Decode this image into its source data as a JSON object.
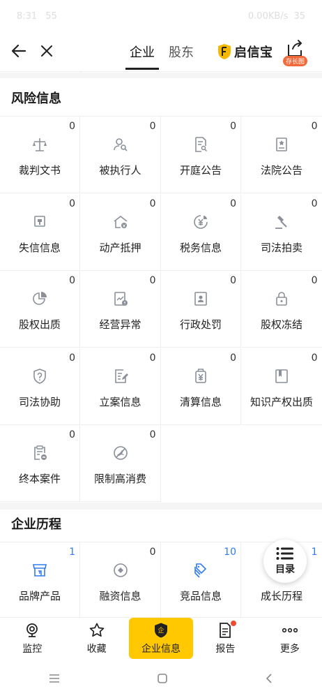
{
  "status_bar": {
    "time": "8:31",
    "extra": "55",
    "network": "0.00KB/s",
    "battery": "35"
  },
  "header": {
    "tabs": [
      {
        "label": "企业",
        "active": true
      },
      {
        "label": "股东",
        "active": false
      }
    ],
    "brand": {
      "name": "启信宝"
    },
    "share_badge": "存长图"
  },
  "risk_section": {
    "title": "风险信息",
    "items": [
      {
        "label": "裁判文书",
        "count": "0",
        "icon": "scales-icon"
      },
      {
        "label": "被执行人",
        "count": "0",
        "icon": "person-search-icon"
      },
      {
        "label": "开庭公告",
        "count": "0",
        "icon": "document-search-icon"
      },
      {
        "label": "法院公告",
        "count": "0",
        "icon": "court-notice-icon"
      },
      {
        "label": "失信信息",
        "count": "0",
        "icon": "thumbs-down-icon"
      },
      {
        "label": "动产抵押",
        "count": "0",
        "icon": "house-yen-icon"
      },
      {
        "label": "税务信息",
        "count": "0",
        "icon": "tax-yen-icon"
      },
      {
        "label": "司法拍卖",
        "count": "0",
        "icon": "gavel-icon"
      },
      {
        "label": "股权出质",
        "count": "0",
        "icon": "pie-chart-icon"
      },
      {
        "label": "经营异常",
        "count": "0",
        "icon": "chart-warning-icon"
      },
      {
        "label": "行政处罚",
        "count": "0",
        "icon": "id-card-icon"
      },
      {
        "label": "股权冻结",
        "count": "0",
        "icon": "lock-icon"
      },
      {
        "label": "司法协助",
        "count": "0",
        "icon": "shield-question-icon"
      },
      {
        "label": "立案信息",
        "count": "0",
        "icon": "edit-document-icon"
      },
      {
        "label": "清算信息",
        "count": "0",
        "icon": "yen-bag-icon"
      },
      {
        "label": "知识产权出质",
        "count": "0",
        "icon": "book-icon"
      },
      {
        "label": "终本案件",
        "count": "0",
        "icon": "clipboard-minus-icon"
      },
      {
        "label": "限制高消费",
        "count": "0",
        "icon": "no-plane-icon"
      }
    ]
  },
  "history_section": {
    "title": "企业历程",
    "items": [
      {
        "label": "品牌产品",
        "count": "1",
        "icon": "shop-icon",
        "highlight": true
      },
      {
        "label": "融资信息",
        "count": "0",
        "icon": "target-icon",
        "highlight": false
      },
      {
        "label": "竞品信息",
        "count": "10",
        "icon": "tags-icon",
        "highlight": true
      },
      {
        "label": "成长历程",
        "count": "1",
        "icon": "growth-icon",
        "highlight": true
      }
    ]
  },
  "toc_button": {
    "label": "目录"
  },
  "bottom_nav": [
    {
      "label": "监控",
      "icon": "camera-icon"
    },
    {
      "label": "收藏",
      "icon": "star-icon"
    },
    {
      "label": "企业信息",
      "icon": "company-shield-icon",
      "active": true
    },
    {
      "label": "报告",
      "icon": "report-icon",
      "dot": true
    },
    {
      "label": "更多",
      "icon": "more-dots-icon"
    }
  ],
  "colors": {
    "accent": "#ffc800",
    "link_blue": "#2f7bf0",
    "icon_gray": "#8a8f99",
    "alert_red": "#f04b32"
  }
}
